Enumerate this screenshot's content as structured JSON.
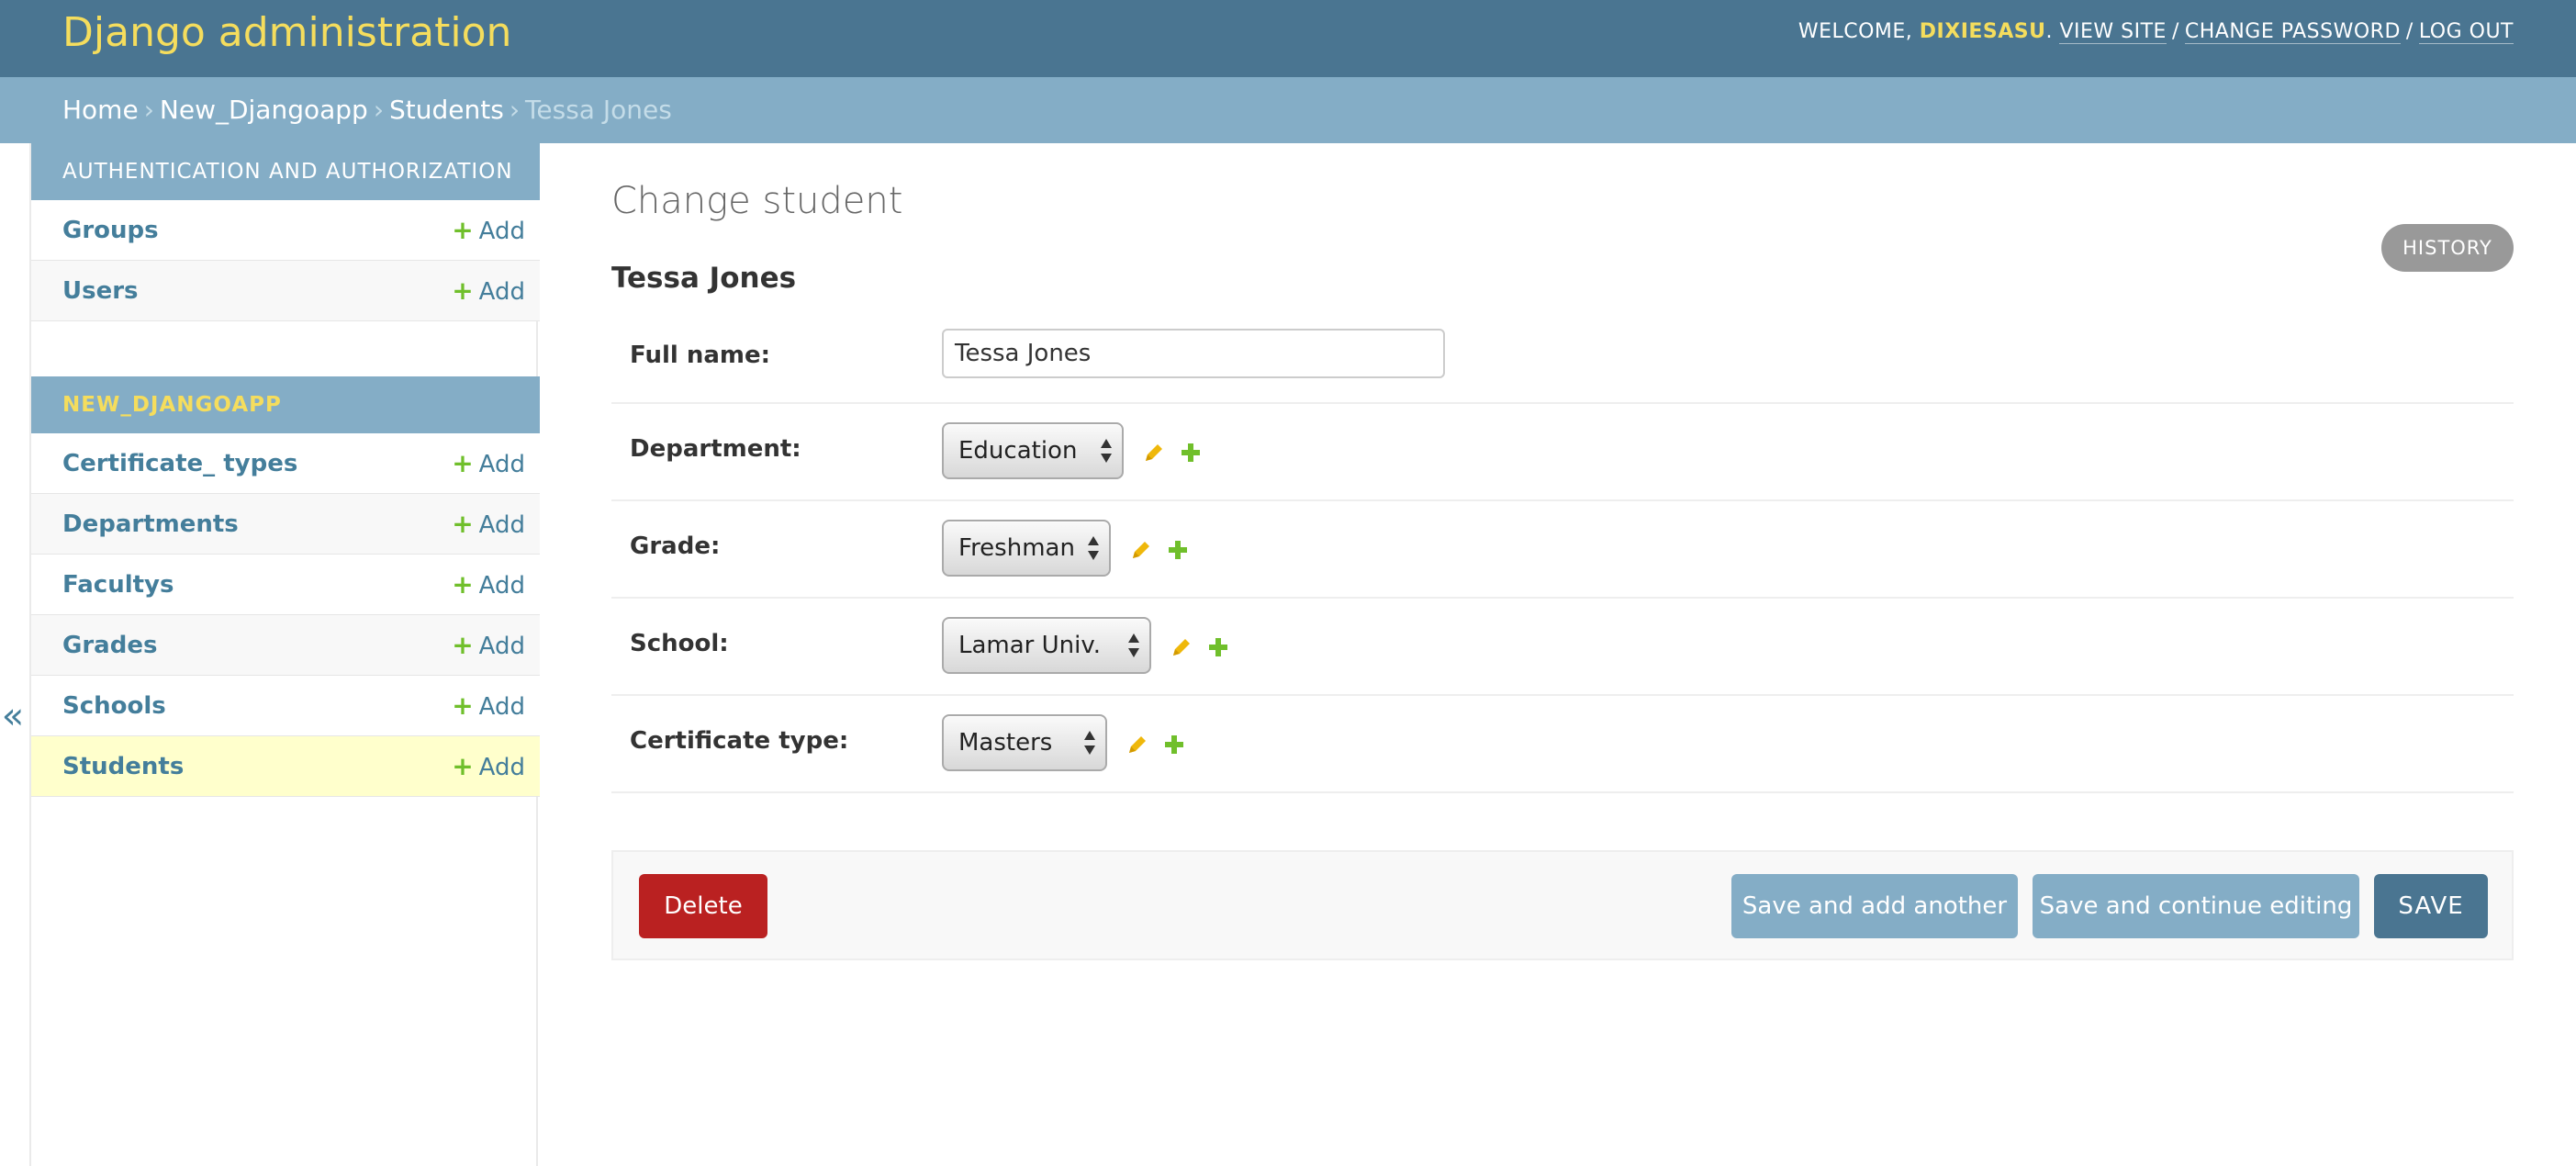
{
  "header": {
    "site_name": "Django administration",
    "welcome": "WELCOME,",
    "username": "DIXIESASU",
    "view_site": "VIEW SITE",
    "change_password": "CHANGE PASSWORD",
    "log_out": "LOG OUT"
  },
  "breadcrumbs": {
    "home": "Home",
    "app": "New_Djangoapp",
    "model": "Students",
    "current": "Tessa Jones"
  },
  "sidebar": {
    "toggle": "«",
    "modules": [
      {
        "caption": "AUTHENTICATION AND AUTHORIZATION",
        "models": [
          {
            "name": "Groups",
            "add": "Add"
          },
          {
            "name": "Users",
            "add": "Add"
          }
        ]
      },
      {
        "caption": "NEW_DJANGOAPP",
        "models": [
          {
            "name": "Certificate_ types",
            "add": "Add"
          },
          {
            "name": "Departments",
            "add": "Add"
          },
          {
            "name": "Facultys",
            "add": "Add"
          },
          {
            "name": "Grades",
            "add": "Add"
          },
          {
            "name": "Schools",
            "add": "Add"
          },
          {
            "name": "Students",
            "add": "Add"
          }
        ]
      }
    ]
  },
  "content": {
    "title": "Change student",
    "history": "HISTORY",
    "object_title": "Tessa Jones",
    "fields": {
      "full_name": {
        "label": "Full name:",
        "value": "Tessa Jones"
      },
      "department": {
        "label": "Department:",
        "value": "Education"
      },
      "grade": {
        "label": "Grade:",
        "value": "Freshman"
      },
      "school": {
        "label": "School:",
        "value": "Lamar Univ."
      },
      "certificate_type": {
        "label": "Certificate type:",
        "value": "Masters"
      }
    }
  },
  "submit": {
    "delete": "Delete",
    "save_add_another": "Save and add another",
    "save_continue": "Save and continue editing",
    "save": "SAVE"
  },
  "icons": {
    "edit": "pencil-icon",
    "add": "plus-icon",
    "collapse": "chevron-double-left-icon"
  },
  "colors": {
    "header_bg": "#4a7591",
    "site_name": "#f5dd5d",
    "breadcrumb_bg": "#84adc6",
    "link": "#447e9b",
    "add_plus": "#70bf2b",
    "edit_pencil": "#efb80b",
    "delete": "#ba2121",
    "selected_row": "#ffffcc"
  }
}
